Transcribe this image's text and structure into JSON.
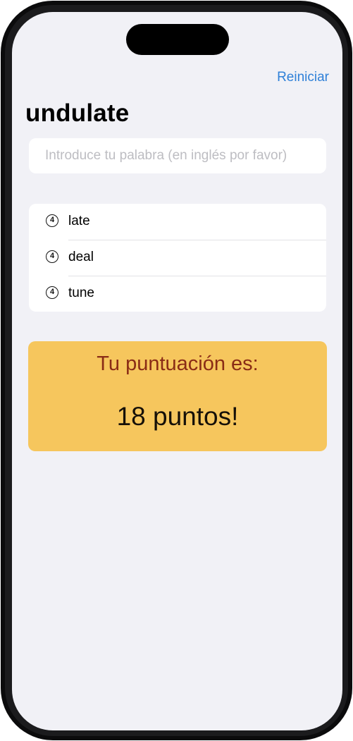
{
  "nav": {
    "restart_label": "Reiniciar"
  },
  "page": {
    "title": "undulate"
  },
  "input": {
    "placeholder": "Introduce tu palabra (en inglés por favor)",
    "value": ""
  },
  "words": [
    {
      "count": "4",
      "word": "late"
    },
    {
      "count": "4",
      "word": "deal"
    },
    {
      "count": "4",
      "word": "tune"
    }
  ],
  "score": {
    "heading": "Tu puntuación es:",
    "value_text": "18 puntos!"
  },
  "colors": {
    "accent": "#2f80d8",
    "background": "#f1f1f6",
    "score_card": "#f6c65d",
    "score_heading": "#8a2c16"
  }
}
